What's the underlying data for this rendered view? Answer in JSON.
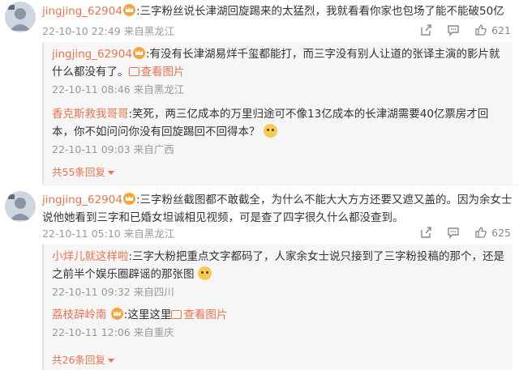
{
  "comments": [
    {
      "user": "jingjing_62904",
      "text": ":三字粉丝说长津湖回旋踢来的太猛烈，我就看看你家也包场了能不能破50亿",
      "date": "22-10-10 22:49",
      "location": "来自黑龙江",
      "likes": "621",
      "replies": [
        {
          "user": "jingjing_62904",
          "has_crown": true,
          "text": ":有没有长津湖易烊千玺都能打，而三字没有别人让道的张译主演的影片就什么都没有了。",
          "view_image": "查看图片",
          "date": "22-10-11 08:46",
          "location": "来自黑龙江"
        },
        {
          "user": "香克斯救我哥哥",
          "has_crown": false,
          "text": ":笑死，两三亿成本的万里归途可不像13亿成本的长津湖需要40亿票房才回本，你不如问问你没有回旋踢回不回得本？",
          "date": "22-10-11 09:03",
          "location": "来自广西"
        }
      ],
      "more_replies": "共55条回复"
    },
    {
      "user": "jingjing_62904",
      "text": ":三字粉丝截图都不敢截全，为什么不能大大方方还要又遮又盖的。因为余女士说他她看到三字和已婚女坦诚相见视频，可是查了四字很久什么都没查到。",
      "date": "22-10-11 05:10",
      "location": "来自黑龙江",
      "likes": "625",
      "replies": [
        {
          "user": "小烊儿就这样啦",
          "has_crown": false,
          "text": ":三字大粉把重点文字都码了，人家余女士说只接到了三字粉投稿的那个，还是之前半个娱乐圈辟谣的那张图",
          "date": "22-10-11 09:32",
          "location": "来自四川"
        },
        {
          "user": "荔枝辞岭南",
          "has_crown": true,
          "text": ":这里这里",
          "view_image": "查看图片",
          "date": "22-10-11 12:06",
          "location": "来自重庆"
        }
      ],
      "more_replies": "共26条回复"
    }
  ],
  "icons": [
    "share-icon",
    "comment-icon",
    "like-icon",
    "crown-badge-icon",
    "view-image-icon",
    "emoji-icon",
    "caret-down-icon"
  ],
  "colors": {
    "username": "#eb7350",
    "meta": "#999999",
    "reply_bg": "#f6f6f6"
  }
}
